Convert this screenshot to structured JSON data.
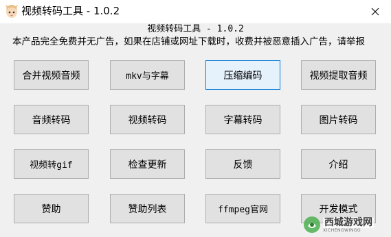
{
  "window": {
    "title": "视频转码工具 - 1.0.2"
  },
  "header": {
    "heading": "视频转码工具 - 1.0.2",
    "notice": "本产品完全免费并无广告，如果在店铺或网址下载时，收费并被恶意插入广告，请举报"
  },
  "buttons": [
    {
      "label": "合并视频音频"
    },
    {
      "label": "mkv与字幕"
    },
    {
      "label": "压缩编码"
    },
    {
      "label": "视频提取音频"
    },
    {
      "label": "音频转码"
    },
    {
      "label": "视频转码"
    },
    {
      "label": "字幕转码"
    },
    {
      "label": "图片转码"
    },
    {
      "label": "视频转gif"
    },
    {
      "label": "检查更新"
    },
    {
      "label": "反馈"
    },
    {
      "label": "介绍"
    },
    {
      "label": "赞助"
    },
    {
      "label": "赞助列表"
    },
    {
      "label": "ffmpeg官网"
    },
    {
      "label": "开发模式"
    }
  ],
  "watermark": {
    "name": "西城游戏网",
    "sub": "XICHENGWINGO"
  },
  "colors": {
    "focus_border": "#0078d7",
    "button_face": "#e1e1e1",
    "window_bg": "#f0f0f0"
  }
}
